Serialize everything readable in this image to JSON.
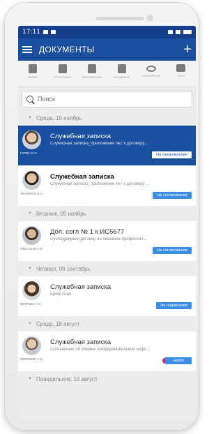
{
  "statusbar": {
    "time": "17:11",
    "left_icons": [
      "settings-gear-icon",
      "notification-icon"
    ],
    "right_icons": [
      "signal-icon",
      "wifi-icon",
      "battery-icon"
    ]
  },
  "appbar": {
    "title": "ДОКУМЕНТЫ",
    "menu_icon": "hamburger-icon",
    "add_icon": "plus-icon"
  },
  "toolbar": {
    "items": [
      {
        "icon": "document-icon",
        "label": "новые"
      },
      {
        "icon": "incoming-icon",
        "label": "полученные"
      },
      {
        "icon": "check-doc-icon",
        "label": "выполненные"
      },
      {
        "icon": "outgoing-icon",
        "label": "исходящие"
      },
      {
        "icon": "eye-icon",
        "label": "на контроле"
      },
      {
        "icon": "chat-icon",
        "label": "чаты"
      }
    ]
  },
  "search": {
    "placeholder": "Поиск"
  },
  "groups": [
    {
      "date": "Среда, 10 ноябрь",
      "items": [
        {
          "author": "ГАРИН С.С.",
          "title": "Служебная записка",
          "subtitle": "Служебная записка_приложение №2 к Договору...",
          "status": "На ознакомление",
          "selected": true,
          "bold": false
        },
        {
          "author": "ТКАЧЕНКО В.А.",
          "title": "Служебная записка",
          "subtitle": "Служебная записка_приложение №7 к Договору ...",
          "status": "На согласование",
          "selected": false,
          "bold": true
        }
      ]
    },
    {
      "date": "Вторник, 09 ноябрь",
      "items": [
        {
          "author": "МОНАХОВ А.В.",
          "title": "Доп. согл № 1 к ИС5677",
          "subtitle": "Субподрядный договор на оказание профессио...",
          "status": "На согласование",
          "selected": false,
          "bold": false
        }
      ]
    },
    {
      "date": "Четверг, 09 сентябрь",
      "items": [
        {
          "author": "ВЕТРОВА К.И.",
          "title": "Служебная записка",
          "subtitle": "Бриф Атач",
          "status": "На подписание",
          "selected": false,
          "bold": false
        }
      ]
    },
    {
      "date": "Среда, 18 август",
      "items": [
        {
          "author": "ЕВРЕМОВ А.Н.",
          "title": "Служебная записка",
          "subtitle": "Соглашение об обмене конфиденциальной инфо...",
          "status": "Новое",
          "selected": false,
          "bold": false
        }
      ]
    },
    {
      "date": "Понедельник, 16 август",
      "items": []
    }
  ],
  "colors": {
    "primary": "#1a4e9e",
    "statusbar": "#153f8a",
    "badge": "#3b8ee6",
    "new_indicator": "#e0245e"
  }
}
